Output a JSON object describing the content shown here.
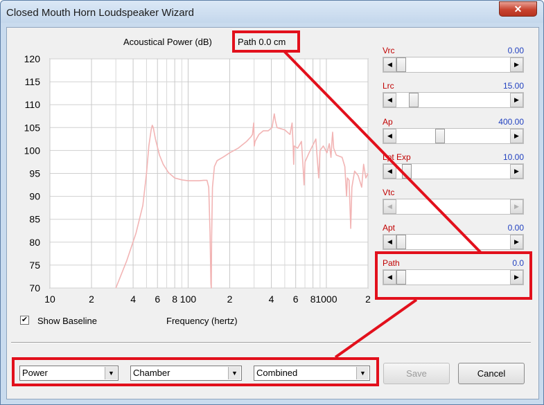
{
  "window": {
    "title": "Closed Mouth Horn Loudspeaker Wizard",
    "close_glyph": "✕"
  },
  "chart": {
    "title": "Acoustical Power (dB)",
    "path_label": "Path 0.0 cm",
    "xlabel": "Frequency (hertz)"
  },
  "chart_data": {
    "type": "line",
    "title": "Acoustical Power (dB)",
    "xlabel": "Frequency (hertz)",
    "ylabel": "",
    "xscale": "log",
    "xlim": [
      10,
      2000
    ],
    "ylim": [
      70,
      120
    ],
    "grid": true,
    "color": "#f2b4b4",
    "y_ticks": [
      "120",
      "115",
      "110",
      "105",
      "100",
      "95",
      "90",
      "85",
      "80",
      "75",
      "70"
    ],
    "x_ticks": [
      {
        "v": 10,
        "label": "10",
        "big": true
      },
      {
        "v": 20,
        "label": "2",
        "big": false
      },
      {
        "v": 40,
        "label": "4",
        "big": false
      },
      {
        "v": 60,
        "label": "6",
        "big": false
      },
      {
        "v": 80,
        "label": "8",
        "big": false
      },
      {
        "v": 100,
        "label": "100",
        "big": true
      },
      {
        "v": 200,
        "label": "2",
        "big": false
      },
      {
        "v": 400,
        "label": "4",
        "big": false
      },
      {
        "v": 600,
        "label": "6",
        "big": false
      },
      {
        "v": 800,
        "label": "8",
        "big": false
      },
      {
        "v": 1000,
        "label": "1000",
        "big": true
      },
      {
        "v": 2000,
        "label": "2",
        "big": false
      }
    ],
    "minor_grid": [
      30,
      50,
      70,
      90,
      300,
      500,
      700,
      900
    ],
    "series": [
      {
        "points": [
          [
            30,
            70
          ],
          [
            36,
            76
          ],
          [
            42,
            82
          ],
          [
            47,
            88
          ],
          [
            50,
            95
          ],
          [
            52,
            101
          ],
          [
            54,
            104.5
          ],
          [
            55,
            105.5
          ],
          [
            56,
            105
          ],
          [
            58,
            102.5
          ],
          [
            62,
            99
          ],
          [
            66,
            97
          ],
          [
            72,
            95.2
          ],
          [
            80,
            94
          ],
          [
            90,
            93.6
          ],
          [
            100,
            93.4
          ],
          [
            110,
            93.4
          ],
          [
            120,
            93.4
          ],
          [
            130,
            93.5
          ],
          [
            137,
            93.5
          ],
          [
            141,
            92
          ],
          [
            144,
            82
          ],
          [
            146,
            71
          ],
          [
            147,
            70
          ],
          [
            148,
            81
          ],
          [
            150,
            92
          ],
          [
            155,
            96.5
          ],
          [
            162,
            97.8
          ],
          [
            180,
            98.6
          ],
          [
            200,
            99.5
          ],
          [
            230,
            100.5
          ],
          [
            265,
            102
          ],
          [
            285,
            103
          ],
          [
            292,
            103.5
          ],
          [
            298,
            106
          ],
          [
            301,
            101
          ],
          [
            305,
            102
          ],
          [
            325,
            103.5
          ],
          [
            350,
            104.3
          ],
          [
            380,
            104.3
          ],
          [
            405,
            105
          ],
          [
            420,
            108
          ],
          [
            428,
            106.5
          ],
          [
            440,
            105
          ],
          [
            500,
            104.5
          ],
          [
            545,
            103.5
          ],
          [
            565,
            106
          ],
          [
            575,
            101
          ],
          [
            580,
            97
          ],
          [
            585,
            101
          ],
          [
            620,
            100.5
          ],
          [
            660,
            102
          ],
          [
            680,
            96
          ],
          [
            690,
            92.5
          ],
          [
            700,
            97.5
          ],
          [
            750,
            99.5
          ],
          [
            840,
            102.5
          ],
          [
            860,
            98
          ],
          [
            880,
            94
          ],
          [
            900,
            100
          ],
          [
            950,
            101
          ],
          [
            1010,
            99.5
          ],
          [
            1050,
            101.5
          ],
          [
            1080,
            98.5
          ],
          [
            1100,
            102.5
          ],
          [
            1110,
            104
          ],
          [
            1130,
            100.5
          ],
          [
            1180,
            99
          ],
          [
            1300,
            98.5
          ],
          [
            1360,
            96.5
          ],
          [
            1400,
            90
          ],
          [
            1420,
            94
          ],
          [
            1460,
            93.5
          ],
          [
            1500,
            83
          ],
          [
            1530,
            92
          ],
          [
            1600,
            95.5
          ],
          [
            1700,
            94.5
          ],
          [
            1800,
            92
          ],
          [
            1860,
            97
          ],
          [
            1930,
            94
          ],
          [
            2000,
            95
          ]
        ]
      }
    ]
  },
  "baseline": {
    "checked": "✔",
    "label": "Show Baseline"
  },
  "controls": [
    {
      "name": "Vrc",
      "value": "0.00",
      "pos": 0.0
    },
    {
      "name": "Lrc",
      "value": "15.00",
      "pos": 0.12
    },
    {
      "name": "Ap",
      "value": "400.00",
      "pos": 0.37
    },
    {
      "name": "Lpt Exp",
      "value": "10.00",
      "pos": 0.05
    },
    {
      "name": "Vtc",
      "value": "",
      "pos": null
    },
    {
      "name": "Apt",
      "value": "0.00",
      "pos": 0.0
    },
    {
      "name": "Path",
      "value": "0.0",
      "pos": 0.0
    }
  ],
  "dropdowns": [
    {
      "value": "Power"
    },
    {
      "value": "Chamber"
    },
    {
      "value": "Combined"
    }
  ],
  "buttons": {
    "save": "Save",
    "cancel": "Cancel"
  },
  "scroll_arrows": {
    "left": "◀",
    "right": "▶",
    "down": "▼"
  },
  "annotation_color": "#e2101c"
}
